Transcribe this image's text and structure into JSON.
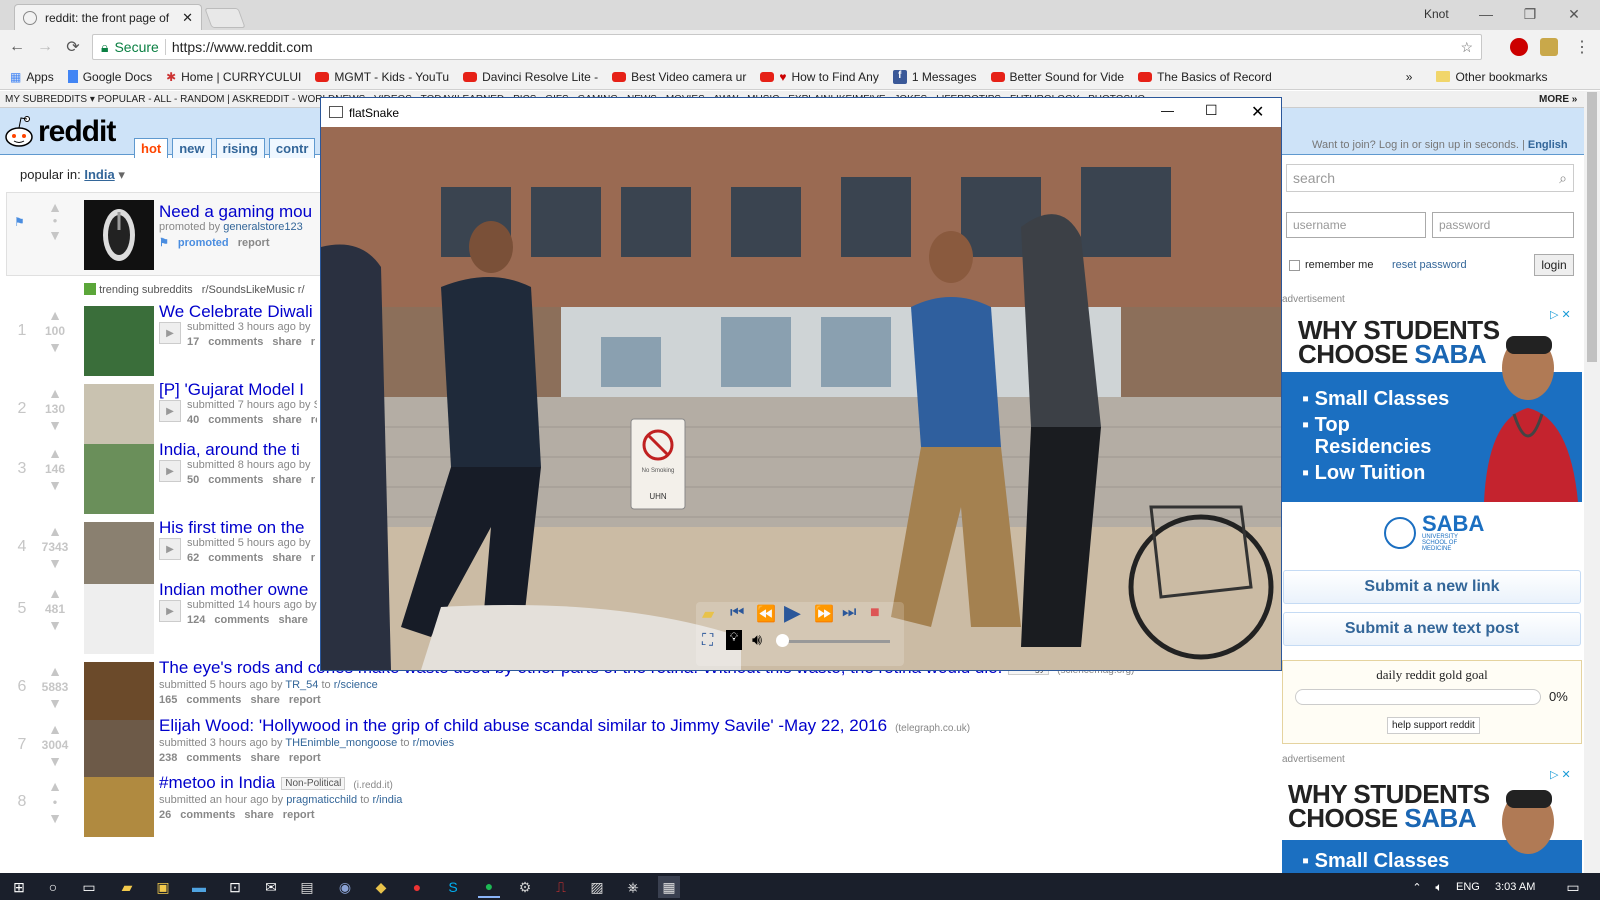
{
  "browser": {
    "tab_title": "reddit: the front page of",
    "profile_label": "Knot",
    "secure_label": "Secure",
    "url": "https://www.reddit.com",
    "bookmarks": [
      "Apps",
      "Google Docs",
      "Home | CURRYCULUI",
      "MGMT - Kids - YouTu",
      "Davinci Resolve Lite -",
      "Best Video camera ur",
      "How to Find Any",
      "1 Messages",
      "Better Sound for Vide",
      "The Basics of Record"
    ],
    "bookmarks_overflow": "»",
    "other_bookmarks": "Other bookmarks"
  },
  "reddit": {
    "subreddit_bar": "MY SUBREDDITS ▾   POPULAR - ALL - RANDOM  |  ASKREDDIT - WORLDNEWS - VIDEOS - TODAYILEARNED - PICS - GIFS - GAMING - NEWS - MOVIES - AWW - MUSIC - EXPLAINLIKEIMFIVE - JOKES - LIFEPROTIPS - FUTUROLOGY - PHOTOSHO",
    "more_label": "MORE »",
    "logo": "reddit",
    "tabs": [
      "hot",
      "new",
      "rising",
      "contr"
    ],
    "join_text": "Want to join? Log in or sign up in seconds. |",
    "language": "English",
    "popular_label": "popular in:",
    "popular_region": "India",
    "promoted": {
      "title": "Need a gaming mou",
      "by": "promoted by",
      "user": "generalstore123",
      "tag": "promoted",
      "report": "report"
    },
    "trending_label": "trending subreddits",
    "trending_first": "r/SoundsLikeMusic  r/",
    "posts": [
      {
        "rank": "1",
        "score": "100",
        "title": "We Celebrate Diwali",
        "meta": "submitted 3 hours ago by",
        "comments": "17 comments",
        "share": "share",
        "report": "r"
      },
      {
        "rank": "2",
        "score": "130",
        "title": "[P] 'Gujarat Model I",
        "meta": "submitted 7 hours ago by Sepul",
        "comments": "40 comments",
        "share": "share",
        "report": "repor"
      },
      {
        "rank": "3",
        "score": "146",
        "title": "India, around the ti",
        "meta": "submitted 8 hours ago by",
        "comments": "50 comments",
        "share": "share",
        "report": "r"
      },
      {
        "rank": "4",
        "score": "7343",
        "title": "His first time on the",
        "meta": "submitted 5 hours ago by",
        "comments": "62 comments",
        "share": "share",
        "report": "r"
      },
      {
        "rank": "5",
        "score": "481",
        "title": "Indian mother owne",
        "meta": "submitted 14 hours ago by",
        "comments": "124 comments",
        "share": "share",
        "report": "r"
      },
      {
        "rank": "6",
        "score": "5883",
        "title": "The eye's rods and cones make waste used by other parts of the retina. Without this waste, the retina would die.",
        "flair": "Biology",
        "domain": "(sciencemag.org)",
        "meta_pre": "submitted 5 hours ago by",
        "user": "TR_54",
        "to": "to",
        "sub": "r/science",
        "comments": "165 comments",
        "share": "share",
        "report": "report"
      },
      {
        "rank": "7",
        "score": "3004",
        "title": "Elijah Wood: 'Hollywood in the grip of child abuse scandal similar to Jimmy Savile' -May 22, 2016",
        "domain": "(telegraph.co.uk)",
        "meta_pre": "submitted 3 hours ago by",
        "user": "THEnimble_mongoose",
        "to": "to",
        "sub": "r/movies",
        "comments": "238 comments",
        "share": "share",
        "report": "report"
      },
      {
        "rank": "8",
        "score": "•",
        "title": "#metoo in India",
        "flair": "Non-Political",
        "domain": "(i.redd.it)",
        "meta_pre": "submitted an hour ago by",
        "user": "pragmaticchild",
        "to": "to",
        "sub": "r/india",
        "comments": "26 comments",
        "share": "share",
        "report": "report"
      }
    ],
    "sidebar": {
      "search_placeholder": "search",
      "username_placeholder": "username",
      "password_placeholder": "password",
      "remember": "remember me",
      "reset": "reset password",
      "login": "login",
      "ad_label": "advertisement",
      "ad_headline_1": "WHY STUDENTS",
      "ad_headline_2a": "CHOOSE ",
      "ad_headline_2b": "SABA",
      "ad_bullets": [
        "Small Classes",
        "Top Residencies",
        "Low Tuition"
      ],
      "ad_logo": "SABA",
      "ad_logo_sub": "UNIVERSITY SCHOOL OF MEDICINE",
      "submit_link": "Submit a new link",
      "submit_text": "Submit a new text post",
      "gold_title": "daily reddit gold goal",
      "gold_percent": "0%",
      "gold_progress": 0,
      "gold_help": "help support reddit",
      "ad2_label": "advertisement",
      "ad2_bullet": "Small Classes"
    }
  },
  "player": {
    "window_title": "flatSnake",
    "sign_text": "No Smoking",
    "sign_logo": "UHN"
  },
  "taskbar": {
    "language": "ENG",
    "time": "3:03 AM"
  }
}
